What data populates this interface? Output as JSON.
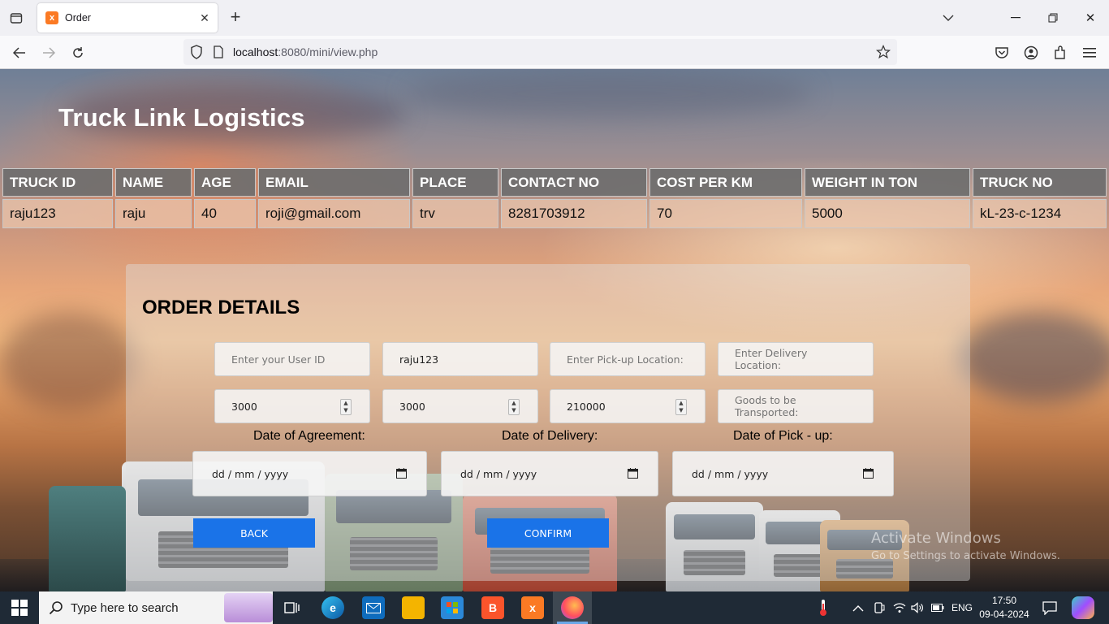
{
  "browser": {
    "tab_title": "Order",
    "url_host": "localhost",
    "url_rest": ":8080/mini/view.php"
  },
  "site": {
    "title": "Truck Link Logistics"
  },
  "truck_table": {
    "headers": [
      "TRUCK ID",
      "NAME",
      "AGE",
      "EMAIL",
      "PLACE",
      "CONTACT NO",
      "COST PER KM",
      "WEIGHT IN TON",
      "TRUCK NO"
    ],
    "rows": [
      [
        "raju123",
        "raju",
        "40",
        "roji@gmail.com",
        "trv",
        "8281703912",
        "70",
        "5000",
        "kL-23-c-1234"
      ]
    ]
  },
  "order": {
    "heading": "ORDER DETAILS",
    "user_id_placeholder": "Enter your User ID",
    "truck_id_value": "raju123",
    "pickup_placeholder": "Enter Pick-up Location:",
    "delivery_placeholder": "Enter Delivery Location:",
    "number1_value": "3000",
    "number2_value": "3000",
    "number3_value": "210000",
    "goods_placeholder": "Goods to be Transported:",
    "date_agreement_label": "Date of Agreement:",
    "date_delivery_label": "Date of Delivery:",
    "date_pickup_label": "Date of Pick - up:",
    "date_placeholder": "dd / mm / yyyy",
    "back_label": "BACK",
    "confirm_label": "CONFIRM"
  },
  "watermark": {
    "line1": "Activate Windows",
    "line2": "Go to Settings to activate Windows."
  },
  "taskbar": {
    "search_text": "Type here to search",
    "language": "ENG",
    "time": "17:50",
    "date": "09-04-2024"
  },
  "colors": {
    "accent_button": "#1a73e8",
    "table_header": "#6e6e6e",
    "taskbar": "#1f2a36"
  }
}
